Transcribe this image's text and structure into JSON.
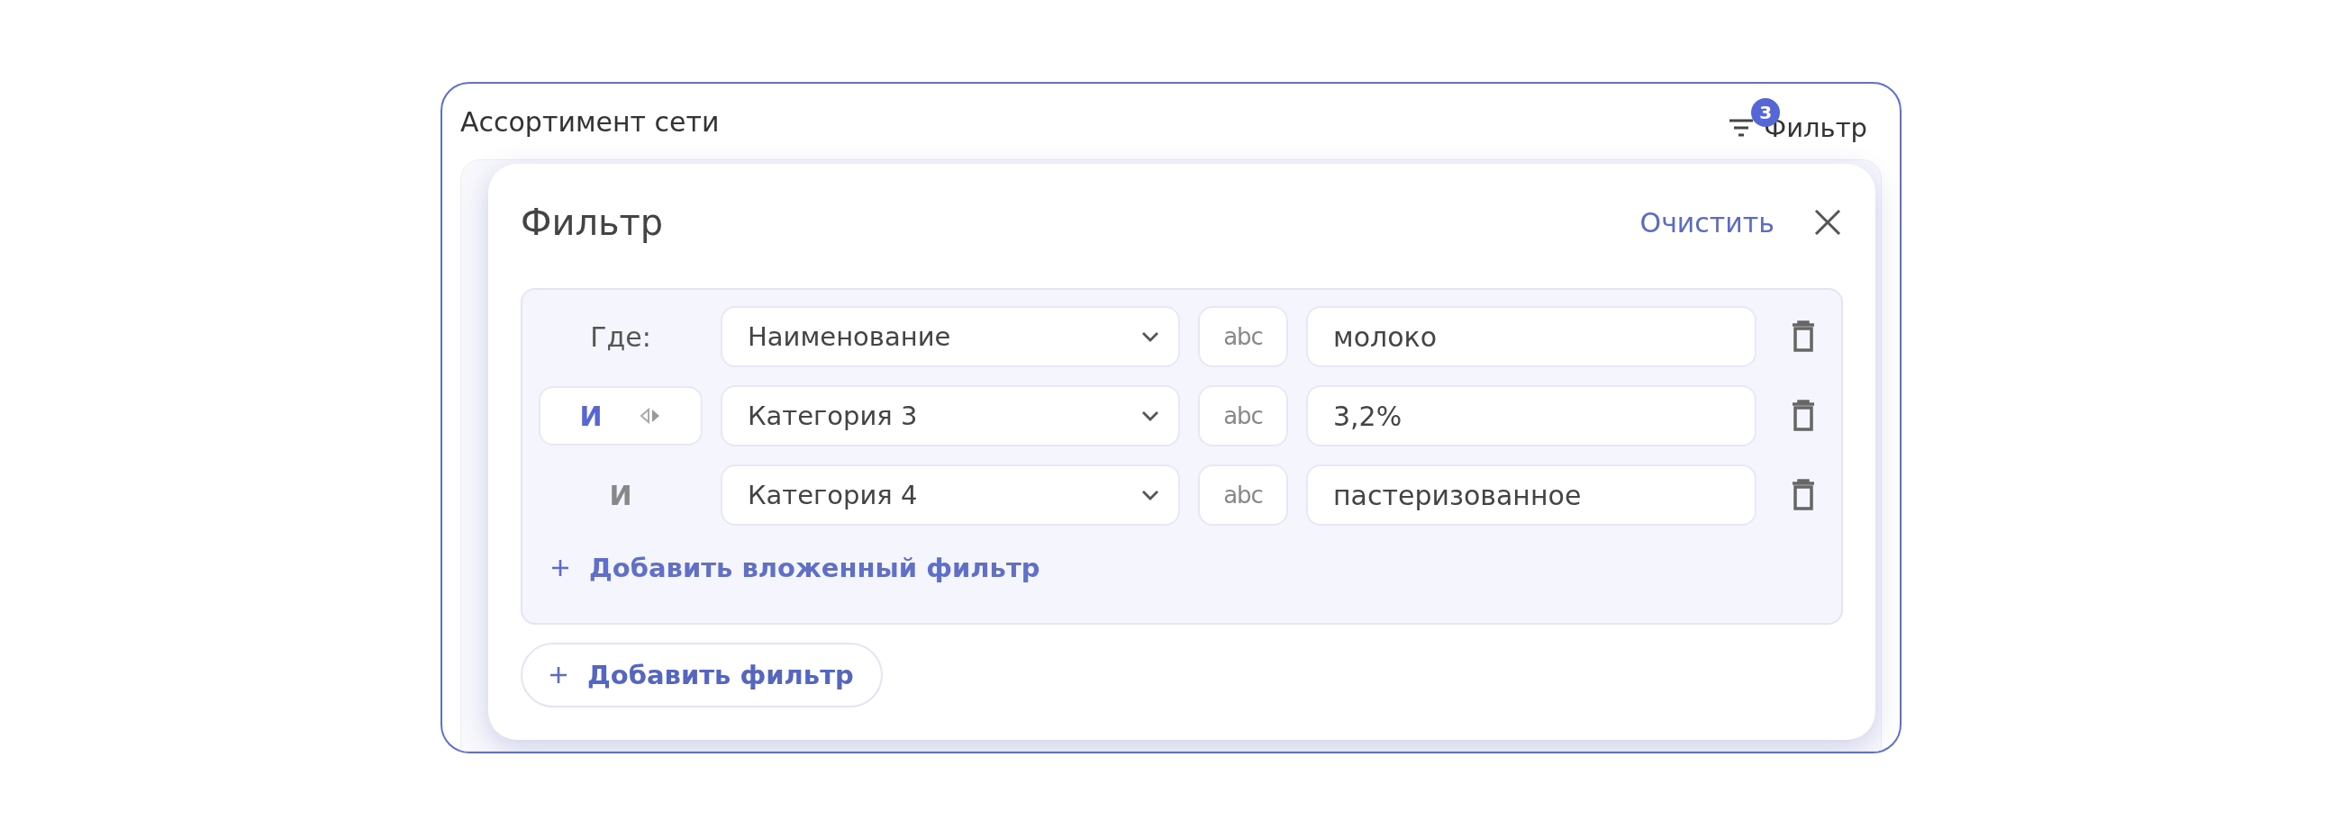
{
  "header": {
    "title": "Ассортимент сети",
    "filter_button": {
      "label": "Фильтр",
      "badge": "3"
    }
  },
  "filter_panel": {
    "title": "Фильтр",
    "clear": "Очистить",
    "rows": [
      {
        "connector": {
          "kind": "label",
          "text": "Где:"
        },
        "field": "Наименование",
        "type_icon": "abc",
        "value": "молоко"
      },
      {
        "connector": {
          "kind": "switch",
          "text": "И"
        },
        "field": "Категория 3",
        "type_icon": "abc",
        "value": "3,2%"
      },
      {
        "connector": {
          "kind": "text",
          "text": "И"
        },
        "field": "Категория 4",
        "type_icon": "abc",
        "value": "пастеризованное"
      }
    ],
    "add_nested": "Добавить вложенный фильтр",
    "add_filter": "Добавить фильтр"
  }
}
